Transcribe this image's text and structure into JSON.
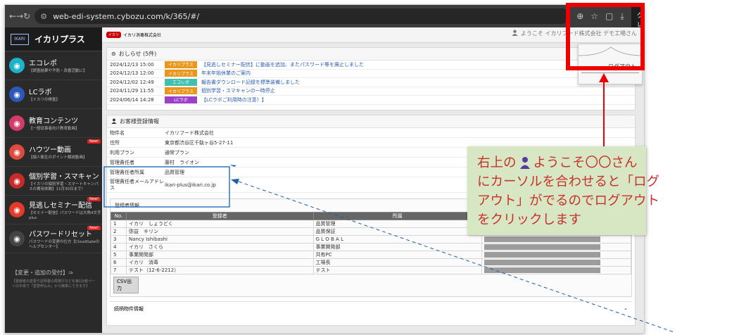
{
  "browser": {
    "url": "web-edi-system.cybozu.com/k/365/#/",
    "incognito_label": "シークレット",
    "icons": [
      "back-icon",
      "forward-icon",
      "reload-icon",
      "site-settings-icon",
      "zoom-icon",
      "bookmark-star-icon",
      "tab-icon",
      "download-icon",
      "incognito-icon"
    ]
  },
  "sidebar": {
    "logo_mark": "IKARI",
    "logo_name": "イカリプラス",
    "items": [
      {
        "label": "エコレポ",
        "sub": "【調査結果や予防・改善活動に】",
        "icon": "eco-icon",
        "color": "#1bb3c8",
        "new": ""
      },
      {
        "label": "LCラボ",
        "sub": "【イカリの検査】",
        "icon": "lab-icon",
        "color": "#2d57b8",
        "new": ""
      },
      {
        "label": "教育コンテンツ",
        "sub": "【一般従事者向け教育動画】",
        "icon": "education-icon",
        "color": "#d43b6a",
        "new": ""
      },
      {
        "label": "ハウツー動画",
        "sub": "【個人衛生のポイント解説動画】",
        "icon": "video-icon",
        "color": "#e04a3c",
        "new": "New!"
      },
      {
        "label": "個別学習・スマキャン",
        "sub": "【イカリの個別学習・スマートキャンパスの費用体験】11月30日まで！",
        "icon": "study-icon",
        "color": "#c82a2a",
        "new": ""
      },
      {
        "label": "見逃しセミナー配信",
        "sub": "【セミナー配信】パスワードは大角4文字plus",
        "icon": "play-icon",
        "color": "#e33a2a",
        "new": "New!"
      },
      {
        "label": "パスワードリセット",
        "sub": "パスワードの変更の仕方【CloudGateのヘルプセンター】",
        "icon": "password-icon",
        "color": "#444444",
        "new": "New!"
      }
    ],
    "footer_title": "【変更・追加の受付】⇒",
    "footer_sub": "【登録者の変更や証明書の再発行などを第1比較ページの中央で「変更申込み」から簡単にできます】"
  },
  "header": {
    "company_logo": "イカリ",
    "company_name": "イカリ消毒株式会社",
    "welcome": "ようこそ イカリフード株式会社 デモ工場さん",
    "logout_label": "ログアウト"
  },
  "news": {
    "title": "おしらせ (5件)",
    "rows": [
      {
        "date": "2024/12/13 15:00",
        "tag": "イカリプラス",
        "tag_color": "#e9961b",
        "title": "【見逃しセミナー配信】に動画を追加、またパスワード等を廃止しました"
      },
      {
        "date": "2024/12/13 12:00",
        "tag": "イカリプラス",
        "tag_color": "#e9961b",
        "title": "年末年始休業のご案内"
      },
      {
        "date": "2024/12/02 12:49",
        "tag": "エコレポ",
        "tag_color": "#3fc1b0",
        "title": "報告書ダウンロード記録を標準装備しました"
      },
      {
        "date": "2024/11/29 11:55",
        "tag": "イカリプラス",
        "tag_color": "#e9961b",
        "title": "個別学習・スマキャンの一時停止"
      },
      {
        "date": "2024/06/14 14:28",
        "tag": "LCラボ",
        "tag_color": "#9b40c9",
        "title": "【LCラボご利用時の注意！】"
      }
    ]
  },
  "customer": {
    "title": "お客様登録情報",
    "rows": [
      {
        "key": "物件名",
        "value": "イカリフード株式会社"
      },
      {
        "key": "住所",
        "value": "東京都渋谷区千駄ヶ谷5-27-11"
      },
      {
        "key": "利用プラン",
        "value": "通常プラン"
      },
      {
        "key": "管理責任者",
        "value": "藤村　ライオン"
      },
      {
        "key": "管理責任者所属",
        "value": "品質管理"
      },
      {
        "key": "管理責任者メールアドレス",
        "value": "ikari-plus@ikari.co.jp"
      }
    ]
  },
  "registrants": {
    "title": "登録者情報",
    "headers": [
      "No.",
      "登録者",
      "所属",
      ""
    ],
    "rows": [
      {
        "no": "1",
        "name": "イカリ　しょうどく",
        "dept": "品質管理"
      },
      {
        "no": "2",
        "name": "弥益　キリン",
        "dept": "品質保証"
      },
      {
        "no": "3",
        "name": "Nancy Ishibashi",
        "dept": "G L O B A L"
      },
      {
        "no": "4",
        "name": "イカリ　さくら",
        "dept": "事業開発部"
      },
      {
        "no": "5",
        "name": "事業開発部",
        "dept": "共有PC"
      },
      {
        "no": "6",
        "name": "イカリ　消毒",
        "dept": "工場長"
      },
      {
        "no": "7",
        "name": "テスト（12-6-2212）",
        "dept": "テスト"
      }
    ],
    "csv_label": "CSV出力"
  },
  "related": {
    "title": "続柄物件情報"
  },
  "annotation": {
    "line1_pre": "右上の",
    "line1_post": "ようこそ〇〇さん",
    "line2": "にカーソルを合わせると「ログ",
    "line3": "アウト」がでるのでログアウト",
    "line4": "をクリックします",
    "text_color": "#c8322c",
    "bg_color": "#d7e7c4",
    "highlight_color": "#ee0000"
  }
}
